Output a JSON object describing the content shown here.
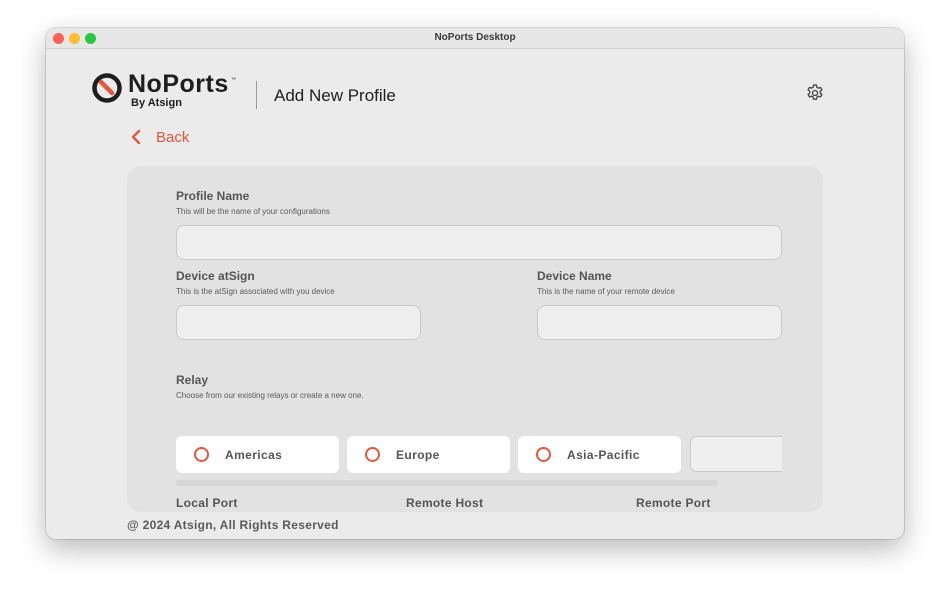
{
  "window": {
    "title": "NoPorts Desktop"
  },
  "brand": {
    "name": "NoPorts",
    "trademark": "™",
    "subtitle": "By Atsign",
    "accent_color": "#e3573f"
  },
  "header": {
    "page_title": "Add New Profile",
    "settings_icon": "gear-icon"
  },
  "nav": {
    "back_label": "Back",
    "back_icon": "chevron-left-icon"
  },
  "form": {
    "profile_name": {
      "label": "Profile Name",
      "hint": "This will be the name of your configurations",
      "value": "",
      "placeholder": ""
    },
    "device_atsign": {
      "label": "Device atSign",
      "hint": "This is the atSign associated with you device",
      "value": "",
      "placeholder": ""
    },
    "device_name": {
      "label": "Device Name",
      "hint": "This is the name of your remote device",
      "value": "",
      "placeholder": ""
    },
    "relay": {
      "label": "Relay",
      "hint": "Choose from our existing relays or create a new one.",
      "options": [
        "Americas",
        "Europe",
        "Asia-Pacific"
      ],
      "custom_value": ""
    },
    "columns": [
      "Local Port",
      "Remote Host",
      "Remote Port"
    ]
  },
  "footer": {
    "copyright": "@ 2024 Atsign, All Rights Reserved"
  }
}
